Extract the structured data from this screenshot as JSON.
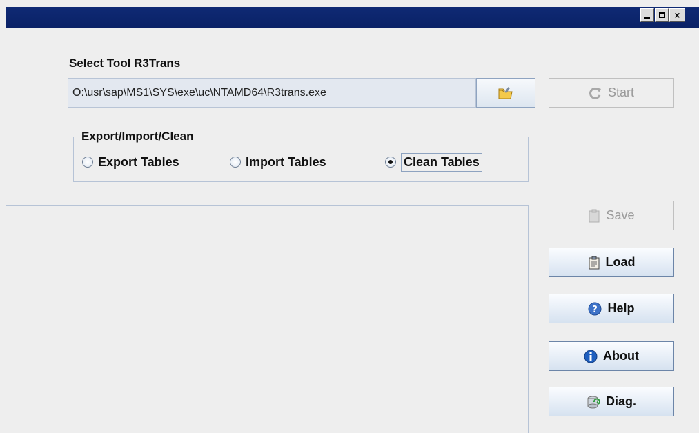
{
  "window": {
    "title": "",
    "controls": {
      "minimize": "minimize",
      "maximize": "maximize",
      "close": "×"
    }
  },
  "tool": {
    "label": "Select Tool R3Trans",
    "path_value": "O:\\usr\\sap\\MS1\\SYS\\exe\\uc\\NTAMD64\\R3trans.exe"
  },
  "mode": {
    "group_title": "Export/Import/Clean",
    "options": [
      {
        "label": "Export Tables",
        "selected": false
      },
      {
        "label": "Import Tables",
        "selected": false
      },
      {
        "label": "Clean Tables",
        "selected": true
      }
    ]
  },
  "buttons": {
    "start": {
      "label": "Start",
      "enabled": false,
      "icon": "refresh-icon"
    },
    "save": {
      "label": "Save",
      "enabled": false,
      "icon": "clipboard-icon"
    },
    "load": {
      "label": "Load",
      "enabled": true,
      "icon": "clipboard-icon"
    },
    "help": {
      "label": "Help",
      "enabled": true,
      "icon": "help-icon"
    },
    "about": {
      "label": "About",
      "enabled": true,
      "icon": "info-icon"
    },
    "diag": {
      "label": "Diag.",
      "enabled": true,
      "icon": "diag-icon"
    }
  },
  "colors": {
    "titlebar": "#0a2166",
    "button_border": "#6c85a8",
    "info_blue": "#1f5fbf"
  }
}
